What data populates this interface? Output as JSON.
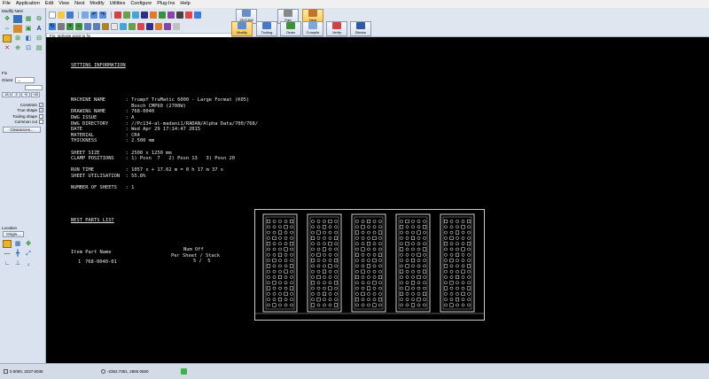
{
  "menu": [
    "File",
    "Application",
    "Edit",
    "View",
    "Nest",
    "Modify",
    "Utilities",
    "Configure",
    "Plug-Ins",
    "Help"
  ],
  "prompt": "Fix: Indicate point to fix",
  "big_buttons": [
    {
      "label": "2D/CAM",
      "active": false
    },
    {
      "label": "Part",
      "active": false
    },
    {
      "label": "Nest",
      "active": true
    },
    {
      "label": "Modify",
      "active": true
    },
    {
      "label": "Tooling",
      "active": false
    },
    {
      "label": "Order",
      "active": false
    },
    {
      "label": "Compile",
      "active": false
    },
    {
      "label": "Verify",
      "active": false
    },
    {
      "label": "Blocks",
      "active": false
    }
  ],
  "left_panel": {
    "title": "Modify Nest",
    "fix_title": "Fix",
    "orient_label": "Orient",
    "orient_value": "→",
    "offsets": [
      "-45",
      "-5",
      "+5",
      "+45"
    ],
    "checks": [
      {
        "label": "Constrain",
        "checked": true
      },
      {
        "label": "True shape",
        "checked": true
      },
      {
        "label": "Tooling shape",
        "checked": false
      },
      {
        "label": "Common cut",
        "checked": false
      }
    ],
    "clearances_label": "Clearances...",
    "location_title": "Location",
    "origin_label": "Origin..."
  },
  "report": {
    "setting_header": "SETTING INFORMATION",
    "setting_lines": [
      "MACHINE NAME       : Trumpf TruMatic 6000 - Large Format (K05)",
      "                     Bosch CMP60 (2700W)",
      "DRAWING NAME       : 768-0040",
      "DWG ISSUE          : A",
      "DWG DIRECTORY      : //Pc134-al-madani1/RADAN/Alpha Data/700/768/",
      "DATE               : Wed Apr 29 17:14:47 2015",
      "MATERIAL           : CR4",
      "THICKNESS          : 2.500 mm",
      "",
      "SHEET SIZE         : 2500 x 1250 mm",
      "CLAMP POSITIONS    : 1) Posn  7   2) Posn 13   3) Posn 20",
      "",
      "RUN TIME           : 1057 s + 17.62 m = 0 h 17 m 37 s",
      "SHEET UTILISATION  : 55.8%",
      "",
      "NUMBER OF SHEETS   : 1"
    ],
    "parts_header": "NEST PARTS LIST",
    "parts_columns": [
      "Item Part Name",
      "Num Off",
      "Per Sheet / Stack"
    ],
    "parts_rows": [
      {
        "item": "1",
        "part": "768-0040-01",
        "num_off": "5 /  5"
      }
    ]
  },
  "status": {
    "coords1": "0.0000, 3237.5035",
    "coords2": "-2362.7351, 2860.0550"
  }
}
